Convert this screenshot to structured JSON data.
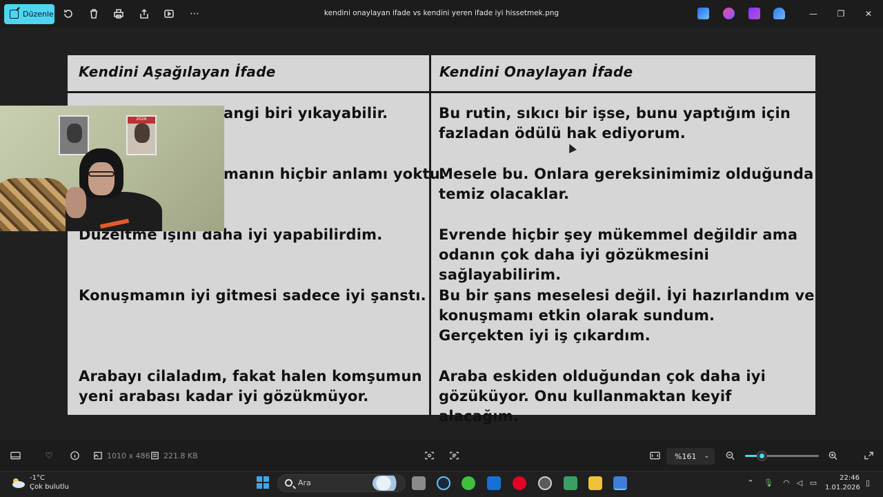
{
  "titlebar": {
    "edit_label": "Düzenle",
    "file_title": "kendini onaylayan ifade vs kendini yeren ifade iyi hissetmek.png",
    "tools": [
      "rotate-icon",
      "delete-icon",
      "print-icon",
      "share-icon",
      "slideshow-icon",
      "more-icon"
    ],
    "app_badges": [
      "designer-app",
      "copilot-app",
      "clipchamp-app",
      "onedrive-app"
    ]
  },
  "document": {
    "header_left": "Kendini Aşağılayan İfade",
    "header_right": "Kendini Onaylayan İfade",
    "rows": [
      {
        "left": "angi biri yıkayabilir.",
        "right": "Bu rutin, sıkıcı bir işse, bunu yaptığım için\nfazladan ödülü hak ediyorum."
      },
      {
        "left": "manın hiçbir anlamı yoktu.",
        "right": "Mesele bu. Onlara gereksinimimiz olduğunda\ntemiz olacaklar."
      },
      {
        "left": "Düzeltme işini daha iyi yapabilirdim.",
        "right": "Evrende hiçbir şey mükemmel değildir ama\nodanın çok daha iyi gözükmesini sağlayabilirim."
      },
      {
        "left": "Konuşmamın iyi gitmesi sadece iyi şanstı.",
        "right": "Bu bir şans  meselesi değil. İyi hazırlandım ve\nkonuşmamı etkin olarak sundum.\nGerçekten iyi iş çıkardım."
      },
      {
        "left": "Arabayı cilaladım, fakat halen komşumun\nyeni arabası kadar iyi gözükmüyor.",
        "right": "Araba eskiden olduğundan çok daha iyi\ngözüküyor. Onu kullanmaktan keyif alacağım."
      }
    ]
  },
  "webcam": {
    "calendar_year": "2026"
  },
  "statusbar": {
    "dimensions": "1010 x 486",
    "file_size": "221.8 KB",
    "zoom": "%161",
    "zoom_level_fraction": 0.22
  },
  "taskbar": {
    "weather_temp": "-1°C",
    "weather_desc": "Çok bulutlu",
    "search_placeholder": "Ara",
    "time": "22:46",
    "date": "1.01.2026"
  },
  "colors": {
    "accent": "#4fd5f0",
    "document_bg": "#d6d6d6"
  }
}
